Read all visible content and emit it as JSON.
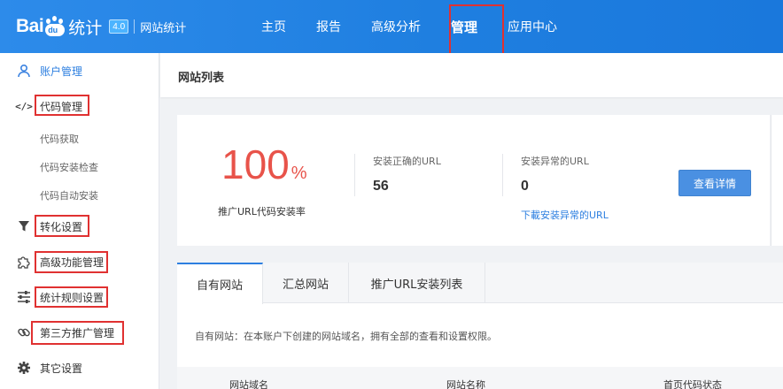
{
  "header": {
    "logo_bai": "Bai",
    "logo_du": "du",
    "logo_stat": "统计",
    "logo_badge": "4.0",
    "logo_sub": "网站统计",
    "nav": [
      "主页",
      "报告",
      "高级分析",
      "管理",
      "应用中心"
    ],
    "active_nav": "管理"
  },
  "sidebar": {
    "account": "账户管理",
    "code": "代码管理",
    "code_sub": [
      "代码获取",
      "代码安装检查",
      "代码自动安装"
    ],
    "conversion": "转化设置",
    "advanced": "高级功能管理",
    "rules": "统计规则设置",
    "third_party": "第三方推广管理",
    "other": "其它设置"
  },
  "main": {
    "page_title": "网站列表",
    "stats": {
      "rate_value": "100",
      "rate_unit": "%",
      "rate_label": "推广URL代码安装率",
      "correct_title": "安装正确的URL",
      "correct_value": "56",
      "abnormal_title": "安装异常的URL",
      "abnormal_value": "0",
      "download_link": "下載安装异常的URL",
      "detail_button": "查看详情"
    },
    "tabs": [
      "自有网站",
      "汇总网站",
      "推广URL安装列表"
    ],
    "active_tab": "自有网站",
    "tab_description": "自有网站：在本账户下创建的网站域名，拥有全部的查看和设置权限。",
    "table_columns": [
      "网站域名",
      "网站名称",
      "首页代码状态"
    ]
  },
  "colors": {
    "header_blue": "#1f7fe0",
    "accent_blue": "#2d7fe0",
    "rate_red": "#e8534a",
    "highlight_red": "#e03131",
    "button_blue": "#4a90e2"
  }
}
